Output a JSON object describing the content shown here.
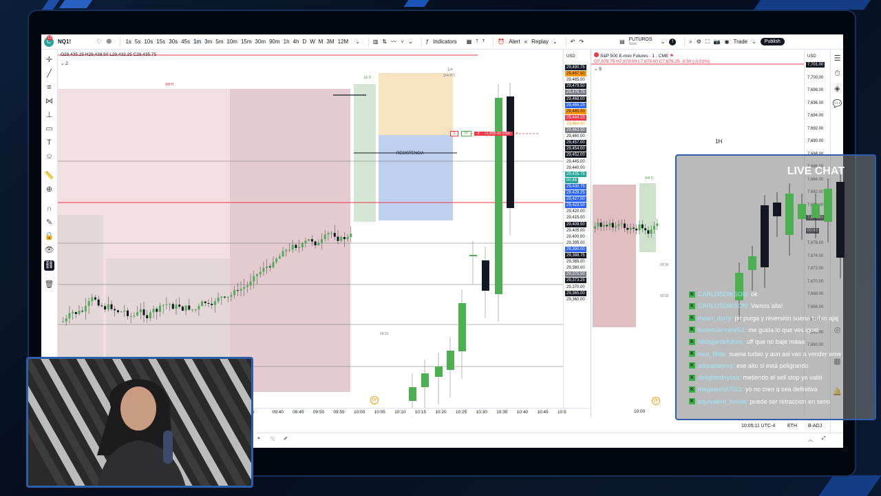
{
  "topbar": {
    "symbol": "NQ1!",
    "intervals": [
      "1s",
      "5s",
      "10s",
      "15s",
      "30s",
      "45s",
      "1m",
      "3m",
      "5m",
      "10m",
      "15m",
      "30m",
      "90m",
      "1h",
      "4h",
      "D",
      "W",
      "M",
      "3M",
      "12M"
    ],
    "active_interval": "1m",
    "indicators_label": "Indicators",
    "alert_label": "Alert",
    "replay_label": "Replay",
    "futuros_label": "FUTUROS",
    "futuros_sub": "Save",
    "trade_label": "Trade",
    "publish_label": "Publish",
    "logo_badge": "13"
  },
  "chart1": {
    "ohlc": "O29,435.25 H29,439.50 L29,433.25 C29,435.75",
    "legend_count": "2",
    "am_h_label": "AM H",
    "jul_d_label": "Jul D",
    "sh_label": "1H",
    "sh_time": "(54:47)",
    "resistencia_label": "RESISTENCIA",
    "order_tp": "TP",
    "order_qty": "-3",
    "order_pnl": "+1,605.00 USD",
    "order_x": "×",
    "order_s": "S",
    "time_label_mid": "09:10",
    "currency": "USD",
    "price_labels": [
      {
        "text": "29,490.75",
        "bg": "#131722",
        "fg": "#ffffff"
      },
      {
        "text": "29,487.50",
        "bg": "#ff9800",
        "fg": "#131722"
      },
      {
        "text": "29,485.00",
        "bg": "",
        "fg": "#131722"
      },
      {
        "text": "29,479.50",
        "bg": "#131722",
        "fg": "#ffffff"
      },
      {
        "text": "29,476.75",
        "bg": "#787b86",
        "fg": "#ffffff"
      },
      {
        "text": "29,468.00",
        "bg": "#131722",
        "fg": "#ffffff"
      },
      {
        "text": "29,465.25",
        "bg": "#2962ff",
        "fg": "#ffffff"
      },
      {
        "text": "29,465.00",
        "bg": "#ff9800",
        "fg": "#131722"
      },
      {
        "text": "29,464.25",
        "bg": "#f23645",
        "fg": "#ffffff"
      },
      {
        "text": "29,464.00",
        "bg": "",
        "fg": "#ff9800"
      },
      {
        "text": "29,463.50",
        "bg": "#787b86",
        "fg": "#ffffff"
      },
      {
        "text": "29,460.00",
        "bg": "",
        "fg": "#131722"
      },
      {
        "text": "29,457.00",
        "bg": "#131722",
        "fg": "#ffffff"
      },
      {
        "text": "29,454.00",
        "bg": "#131722",
        "fg": "#ffffff"
      },
      {
        "text": "29,452.00",
        "bg": "#131722",
        "fg": "#ffffff"
      },
      {
        "text": "29,445.00",
        "bg": "",
        "fg": "#131722"
      },
      {
        "text": "29,440.00",
        "bg": "",
        "fg": "#131722"
      },
      {
        "text": "29,435.75",
        "bg": "#26a69a",
        "fg": "#ffffff"
      },
      {
        "text": "00:48",
        "bg": "#26a69a",
        "fg": "#ffffff"
      },
      {
        "text": "29,430.75",
        "bg": "#2962ff",
        "fg": "#ffffff"
      },
      {
        "text": "29,428.25",
        "bg": "#2962ff",
        "fg": "#ffffff"
      },
      {
        "text": "29,427.50",
        "bg": "#2962ff",
        "fg": "#ffffff"
      },
      {
        "text": "29,423.50",
        "bg": "#2962ff",
        "fg": "#ffffff"
      },
      {
        "text": "29,420.00",
        "bg": "",
        "fg": "#131722"
      },
      {
        "text": "29,415.00",
        "bg": "",
        "fg": "#131722"
      },
      {
        "text": "29,409.50",
        "bg": "#131722",
        "fg": "#ffffff"
      },
      {
        "text": "29,405.00",
        "bg": "",
        "fg": "#131722"
      },
      {
        "text": "29,400.00",
        "bg": "",
        "fg": "#131722"
      },
      {
        "text": "29,395.00",
        "bg": "",
        "fg": "#131722"
      },
      {
        "text": "29,390.00",
        "bg": "#2962ff",
        "fg": "#ffffff"
      },
      {
        "text": "29,388.75",
        "bg": "#131722",
        "fg": "#ffffff"
      },
      {
        "text": "29,385.00",
        "bg": "",
        "fg": "#131722"
      },
      {
        "text": "29,380.00",
        "bg": "",
        "fg": "#131722"
      },
      {
        "text": "29,375.50",
        "bg": "#787b86",
        "fg": "#ffffff"
      },
      {
        "text": "29,373.25",
        "bg": "#131722",
        "fg": "#ffffff"
      },
      {
        "text": "29,370.00",
        "bg": "",
        "fg": "#131722"
      },
      {
        "text": "29,365.00",
        "bg": "#131722",
        "fg": "#ffffff"
      },
      {
        "text": "29,360.00",
        "bg": "",
        "fg": "#131722"
      }
    ],
    "time_labels": [
      "5",
      "09:40",
      "09:45",
      "09:50",
      "09:55",
      "10:00",
      "10:05",
      "10:10",
      "10:15",
      "10:20",
      "10:25",
      "10:30",
      "10:35",
      "10:40",
      "10:45",
      "10:5"
    ]
  },
  "chart2": {
    "title": "S&P 500 E-mini Futures · 1 · CME",
    "ohlc": "O7,678.75 H7,679.00 L7,678.00 C7,678.25 -0.50 (-0.01%)",
    "legend_count": "5",
    "timeframe_label": "1H",
    "am_d_label": "AM D",
    "currency": "USD",
    "side_time_1": "09:30",
    "side_time_2": "00:00",
    "time_label": "10:00",
    "price_labels": [
      {
        "text": "7,701.00",
        "bg": "#131722",
        "fg": "#ffffff"
      },
      {
        "text": "7,700.00",
        "bg": "",
        "fg": "#131722"
      },
      {
        "text": "7,698.00",
        "bg": "",
        "fg": "#131722"
      },
      {
        "text": "7,696.00",
        "bg": "",
        "fg": "#131722"
      },
      {
        "text": "7,694.00",
        "bg": "",
        "fg": "#131722"
      },
      {
        "text": "7,692.00",
        "bg": "",
        "fg": "#131722"
      },
      {
        "text": "7,690.00",
        "bg": "",
        "fg": "#131722"
      },
      {
        "text": "7,688.00",
        "bg": "",
        "fg": "#131722"
      },
      {
        "text": "7,686.00",
        "bg": "",
        "fg": "#131722"
      },
      {
        "text": "7,684.00",
        "bg": "",
        "fg": "#131722"
      },
      {
        "text": "7,682.00",
        "bg": "",
        "fg": "#131722"
      },
      {
        "text": "7,680.00",
        "bg": "",
        "fg": "#131722"
      },
      {
        "text": "7,678.25",
        "bg": "#131722",
        "fg": "#ffffff"
      },
      {
        "text": "00:48",
        "bg": "#131722",
        "fg": "#ffffff"
      },
      {
        "text": "7,676.00",
        "bg": "",
        "fg": "#131722"
      },
      {
        "text": "7,674.00",
        "bg": "",
        "fg": "#131722"
      },
      {
        "text": "7,672.00",
        "bg": "",
        "fg": "#131722"
      },
      {
        "text": "7,670.00",
        "bg": "",
        "fg": "#131722"
      },
      {
        "text": "7,668.00",
        "bg": "",
        "fg": "#131722"
      },
      {
        "text": "7,666.00",
        "bg": "",
        "fg": "#131722"
      },
      {
        "text": "7,664.00",
        "bg": "",
        "fg": "#131722"
      },
      {
        "text": "7,662.00",
        "bg": "",
        "fg": "#131722"
      },
      {
        "text": "7,660.00",
        "bg": "",
        "fg": "#131722"
      }
    ]
  },
  "bottombar": {
    "clock": "10:05:11 UTC-4",
    "session": "ETH",
    "adj": "B-ADJ"
  },
  "livechat": {
    "title": "LIVE CHAT",
    "messages": [
      {
        "user": "CARLOSDIKSON:",
        "text": "ok"
      },
      {
        "user": "CARLOSDIKSON:",
        "text": "Vamos alla!"
      },
      {
        "user": "mean_dorry:",
        "text": "pir purga y reversión suena turbio ajaj"
      },
      {
        "user": "foolishJennine51:",
        "text": "me gusta lo que ves igual"
      },
      {
        "user": "hildagardefuture:",
        "text": "uff que no baje maaa"
      },
      {
        "user": "nice_filide:",
        "text": "suena turbio y aun asi vas a vender wow"
      },
      {
        "user": "adorablelvvy:",
        "text": "ese alto si está peligrando"
      },
      {
        "user": "delightednyssa:",
        "text": "metiendo el sell stop ya valió"
      },
      {
        "user": "megaawful7023:",
        "text": "yo no creo q sea definitiva"
      },
      {
        "user": "equivalent_lorelei:",
        "text": "puede ser retraccion en serio"
      }
    ]
  },
  "colors": {
    "bull": "#4caf50",
    "bear": "#131722",
    "accent": "#2962ff",
    "frame": "#2b5fae"
  }
}
